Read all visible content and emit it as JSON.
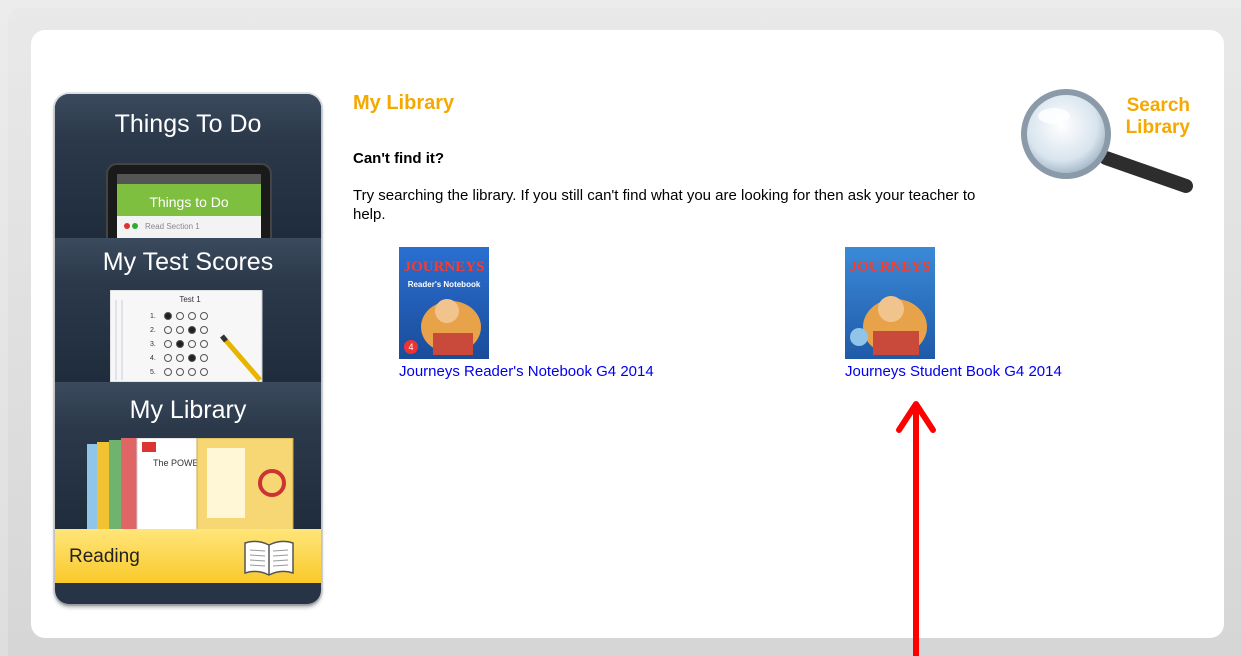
{
  "sidebar": {
    "things_to_do": {
      "title": "Things To Do",
      "device_label": "Things to Do",
      "device_sub": "Read Section 1"
    },
    "test_scores": {
      "title": "My Test Scores",
      "sheet_title": "Test 1",
      "rows": [
        "1.",
        "2.",
        "3.",
        "4.",
        "5."
      ]
    },
    "library": {
      "title": "My Library",
      "book_title": "The POWER of Magnets"
    },
    "reading": {
      "label": "Reading"
    }
  },
  "main": {
    "title": "My Library",
    "help_heading": "Can't find it?",
    "help_text": "Try searching the library. If you still can't find what you are looking for then ask your teacher to help.",
    "search": {
      "line1": "Search",
      "line2": "Library"
    },
    "books": [
      {
        "title": "Journeys Reader's Notebook G4 2014",
        "cover_brand": "JOURNEYS",
        "cover_sub": "Reader's Notebook",
        "grade": "4"
      },
      {
        "title": "Journeys Student Book G4 2014",
        "cover_brand": "JOURNEYS"
      }
    ]
  },
  "colors": {
    "accent": "#f5a800",
    "link": "#0000ee",
    "annotation": "#ff0000"
  }
}
